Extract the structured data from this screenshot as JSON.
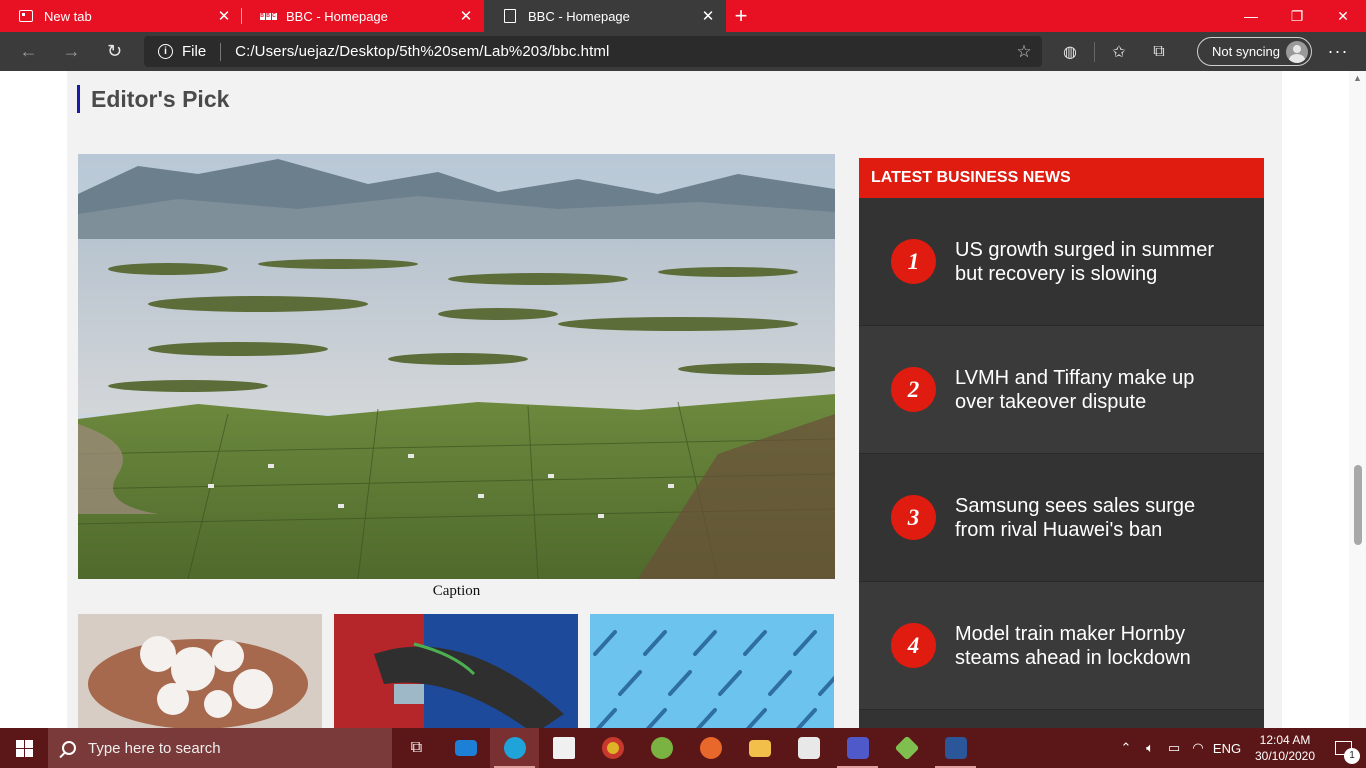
{
  "browser": {
    "tabs": [
      {
        "title": "New tab",
        "icon": "new-tab-page-icon",
        "active": false
      },
      {
        "title": "BBC - Homepage",
        "icon": "bbc-favicon-icon",
        "active": false
      },
      {
        "title": "BBC - Homepage",
        "icon": "page-icon",
        "active": true
      }
    ],
    "address": {
      "scheme_label": "File",
      "url": "C:/Users/uejaz/Desktop/5th%20sem/Lab%203/bbc.html"
    },
    "sync_label": "Not syncing",
    "colors": {
      "frame": "#e81123",
      "toolbar": "#3b3b3b"
    }
  },
  "page": {
    "section_title": "Editor's Pick",
    "hero_caption": "Caption",
    "news": {
      "heading": "LATEST BUSINESS NEWS",
      "items": [
        {
          "num": "1",
          "headline": "US growth surged in summer but recovery is slowing"
        },
        {
          "num": "2",
          "headline": "LVMH and Tiffany make up over takeover dispute"
        },
        {
          "num": "3",
          "headline": "Samsung sees sales surge from rival Huawei's ban"
        },
        {
          "num": "4",
          "headline": "Model train maker Hornby steams ahead in lockdown"
        }
      ]
    },
    "colors": {
      "accent_red": "#e01b0f",
      "title_bar_blue": "#1a1aa8",
      "news_bg": "#333333"
    }
  },
  "taskbar": {
    "search_placeholder": "Type here to search",
    "language": "ENG",
    "time": "12:04 AM",
    "date": "30/10/2020",
    "notification_count": "1"
  }
}
